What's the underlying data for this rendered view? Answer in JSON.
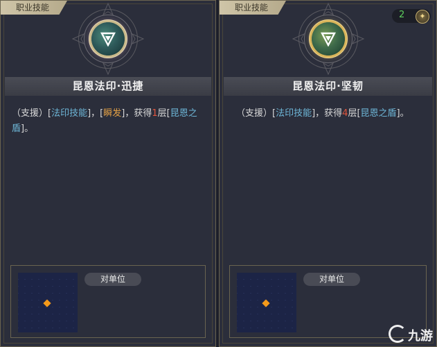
{
  "cards": [
    {
      "category_tag": "职业技能",
      "skill_name": "昆恩法印·迅捷",
      "desc": {
        "p1": "（支援）[",
        "k1": "法印技能",
        "p2": "]，[",
        "k2": "瞬发",
        "p3": "]，获得",
        "num": "1",
        "p4": "层[",
        "k3": "昆恩之盾",
        "p5": "]。"
      },
      "target_label": "对单位",
      "icon": "triangle-sign-icon"
    },
    {
      "category_tag": "职业技能",
      "skill_name": "昆恩法印·坚韧",
      "desc": {
        "p1": "（支援）[",
        "k1": "法印技能",
        "p2": "]，获得",
        "num": "4",
        "p3": "层[",
        "k2": "昆恩之盾",
        "p4": "]。"
      },
      "target_label": "对单位",
      "cost": "2",
      "icon": "triangle-sign-icon"
    }
  ],
  "watermark": {
    "text": "九游"
  },
  "colors": {
    "keyword": "#6eb7d8",
    "instant": "#e3a045",
    "number": "#e2553d",
    "cost": "#5ed05e"
  }
}
